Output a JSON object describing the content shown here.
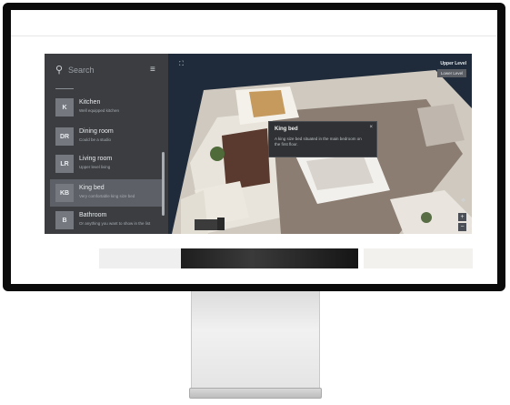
{
  "viewer": {
    "search": {
      "placeholder": "Search"
    },
    "rooms": [
      {
        "badge": "K",
        "title": "Kitchen",
        "subtitle": "Well equipped kitchen"
      },
      {
        "badge": "DR",
        "title": "Dining room",
        "subtitle": "Could be a studio"
      },
      {
        "badge": "LR",
        "title": "Living room",
        "subtitle": "Upper level living"
      },
      {
        "badge": "KB",
        "title": "King bed",
        "subtitle": "Very comfortable king size bed"
      },
      {
        "badge": "B",
        "title": "Bathroom",
        "subtitle": "Or anything you want to show in the list"
      }
    ],
    "selected_room": "King bed",
    "tooltip": {
      "title": "King bed",
      "body": "A king size bed situated in the main bedroom on the first floor.",
      "close": "×"
    },
    "level": {
      "title": "Upper Level",
      "button": "Lower Level"
    },
    "controls": {
      "zoom_in": "+",
      "zoom_out": "−"
    }
  },
  "colors": {
    "panel": "#3b3d40",
    "selected": "#5d6066",
    "viewer_background": "#1f2b3a",
    "frame": "#0b0b0b"
  }
}
